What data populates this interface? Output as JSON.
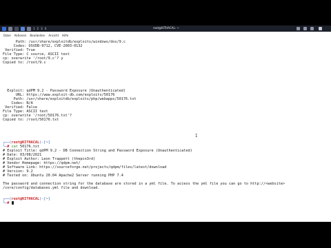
{
  "taskbar": {
    "workspaces": [
      "1",
      "2",
      "3",
      "4"
    ],
    "window_title": "root@KITHACAL: ~"
  },
  "menu": [
    "Datei",
    "Aktionen",
    "Bearbeiten",
    "Ansicht",
    "Hilfe"
  ],
  "terminal": {
    "block1": [
      "      Path: /usr/share/exploitdb/exploits/windows/dos/9.c",
      "     Codes: OSVDB-9712, CVE-2003-0132",
      " Verified: True",
      "File Type: C source, ASCII text",
      "cp: overwrite '/root/9.c'? y",
      "Copied to: /root/9.c"
    ],
    "block2": [
      "  Exploit: qdPM 9.2 - Password Exposure (Unauthenticated)",
      "      URL: https://www.exploit-db.com/exploits/50176",
      "     Path: /usr/share/exploitdb/exploits/php/webapps/50176.txt",
      "    Codes: N/A",
      " Verified: False",
      "File Type: ASCII text",
      "cp: overwrite '/root/50176.txt'? ",
      "Copied to: /root/50176.txt"
    ],
    "prompt1_user": "root@KITHACAL",
    "prompt1_path": "~",
    "cmd1_keyword": "cat",
    "cmd1_arg": "50176.txt",
    "block3": [
      "# Exploit Title: qdPM 9.2 - DB Connection String and Password Exposure (Unauthenticated)",
      "# Date: 03/08/2021",
      "# Exploit Author: Leon Trappett (thepcn3rd)",
      "# Vendor Homepage: https://qdpm.net/",
      "# Software Link: https://sourceforge.net/projects/qdpm/files/latest/download",
      "# Version: 9.2",
      "# Tested on: Ubuntu 20.04 Apache2 Server running PHP 7.4"
    ],
    "block4": [
      "The password and connection string for the database are stored in a yml file. To access the yml file you can go to http://<website>",
      "/core/config/databases.yml file and download."
    ],
    "prompt2_user": "root@KITHACAL",
    "prompt2_path": "~"
  }
}
